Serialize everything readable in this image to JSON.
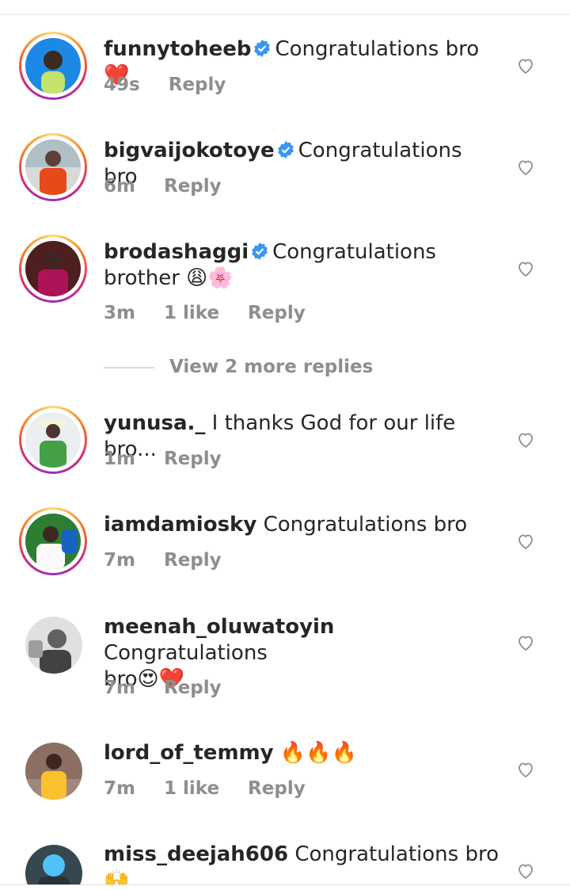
{
  "comments": [
    {
      "username": "funnytoheeb",
      "verified": true,
      "text": "Congratulations bro",
      "emoji": "❤️",
      "time": "49s",
      "likes": "",
      "reply": "Reply"
    },
    {
      "username": "bigvaijokotoye",
      "verified": true,
      "text": "Congratulations bro",
      "emoji": "",
      "time": "6m",
      "likes": "",
      "reply": "Reply"
    },
    {
      "username": "brodashaggi",
      "verified": true,
      "text": "Congratulations",
      "text2": "brother",
      "emoji": "😩🌸",
      "time": "3m",
      "likes": "1 like",
      "reply": "Reply"
    },
    {
      "username": "yunusa._",
      "verified": false,
      "text": "I thanks God for our life bro...",
      "emoji": "",
      "time": "1m",
      "likes": "",
      "reply": "Reply"
    },
    {
      "username": "iamdamiosky",
      "verified": false,
      "text": "Congratulations bro",
      "emoji": "",
      "time": "7m",
      "likes": "",
      "reply": "Reply"
    },
    {
      "username": "meenah_oluwatoyin",
      "verified": false,
      "text": "Congratulations",
      "text2": "bro",
      "emoji": "😍❤️",
      "time": "7m",
      "likes": "",
      "reply": "Reply"
    },
    {
      "username": "lord_of_temmy",
      "verified": false,
      "text": "",
      "emoji": "🔥🔥🔥",
      "time": "7m",
      "likes": "1 like",
      "reply": "Reply"
    },
    {
      "username": "miss_deejah606",
      "verified": false,
      "text": "Congratulations bro",
      "emoji": "🙌",
      "emoji2": "❤️",
      "time": "",
      "likes": "",
      "reply": ""
    }
  ],
  "view_more_replies": "View 2 more replies",
  "colors": {
    "verified": "#3897f0",
    "muted": "#8e8e8e",
    "text": "#262626"
  },
  "icons": {
    "like": "heart-outline-icon",
    "verified": "verified-badge-icon"
  }
}
